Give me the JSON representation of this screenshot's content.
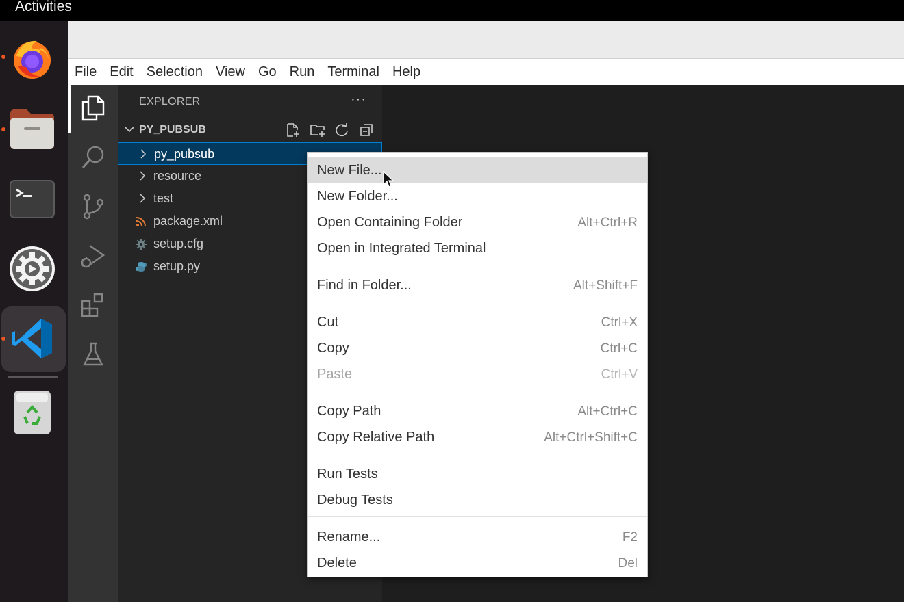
{
  "topbar": {
    "activities": "Activities"
  },
  "dock": {
    "items": [
      {
        "name": "firefox-icon",
        "running": true
      },
      {
        "name": "files-icon",
        "running": true
      },
      {
        "name": "terminal-icon",
        "running": false
      },
      {
        "name": "settings-icon",
        "running": false
      },
      {
        "name": "vscode-icon",
        "running": true,
        "active": true
      },
      {
        "name": "trash-icon",
        "running": false
      }
    ]
  },
  "menubar": {
    "items": [
      "File",
      "Edit",
      "Selection",
      "View",
      "Go",
      "Run",
      "Terminal",
      "Help"
    ]
  },
  "activitybar": {
    "icons": [
      "files-icon",
      "search-icon",
      "source-control-icon",
      "run-debug-icon",
      "extensions-icon",
      "testing-icon"
    ]
  },
  "explorer": {
    "title": "EXPLORER",
    "more": "···",
    "section_title": "PY_PUBSUB",
    "section_actions": [
      "new-file-icon",
      "new-folder-icon",
      "refresh-icon",
      "collapse-all-icon"
    ],
    "tree": [
      {
        "label": "py_pubsub",
        "type": "folder",
        "selected": true
      },
      {
        "label": "resource",
        "type": "folder"
      },
      {
        "label": "test",
        "type": "folder"
      },
      {
        "label": "package.xml",
        "type": "file",
        "icon": "rss-icon"
      },
      {
        "label": "setup.cfg",
        "type": "file",
        "icon": "gear-icon"
      },
      {
        "label": "setup.py",
        "type": "file",
        "icon": "python-icon"
      }
    ]
  },
  "context_menu": {
    "items": [
      {
        "label": "New File...",
        "shortcut": "",
        "hover": true
      },
      {
        "label": "New Folder...",
        "shortcut": ""
      },
      {
        "label": "Open Containing Folder",
        "shortcut": "Alt+Ctrl+R"
      },
      {
        "label": "Open in Integrated Terminal",
        "shortcut": ""
      },
      {
        "label": "Find in Folder...",
        "shortcut": "Alt+Shift+F"
      },
      {
        "label": "Cut",
        "shortcut": "Ctrl+X"
      },
      {
        "label": "Copy",
        "shortcut": "Ctrl+C"
      },
      {
        "label": "Paste",
        "shortcut": "Ctrl+V",
        "disabled": true
      },
      {
        "label": "Copy Path",
        "shortcut": "Alt+Ctrl+C"
      },
      {
        "label": "Copy Relative Path",
        "shortcut": "Alt+Ctrl+Shift+C"
      },
      {
        "label": "Run Tests",
        "shortcut": ""
      },
      {
        "label": "Debug Tests",
        "shortcut": ""
      },
      {
        "label": "Rename...",
        "shortcut": "F2"
      },
      {
        "label": "Delete",
        "shortcut": "Del"
      }
    ]
  },
  "colors": {
    "accent": "#007fd4",
    "selection": "#04395e",
    "ubuntu_orange": "#e95420"
  }
}
